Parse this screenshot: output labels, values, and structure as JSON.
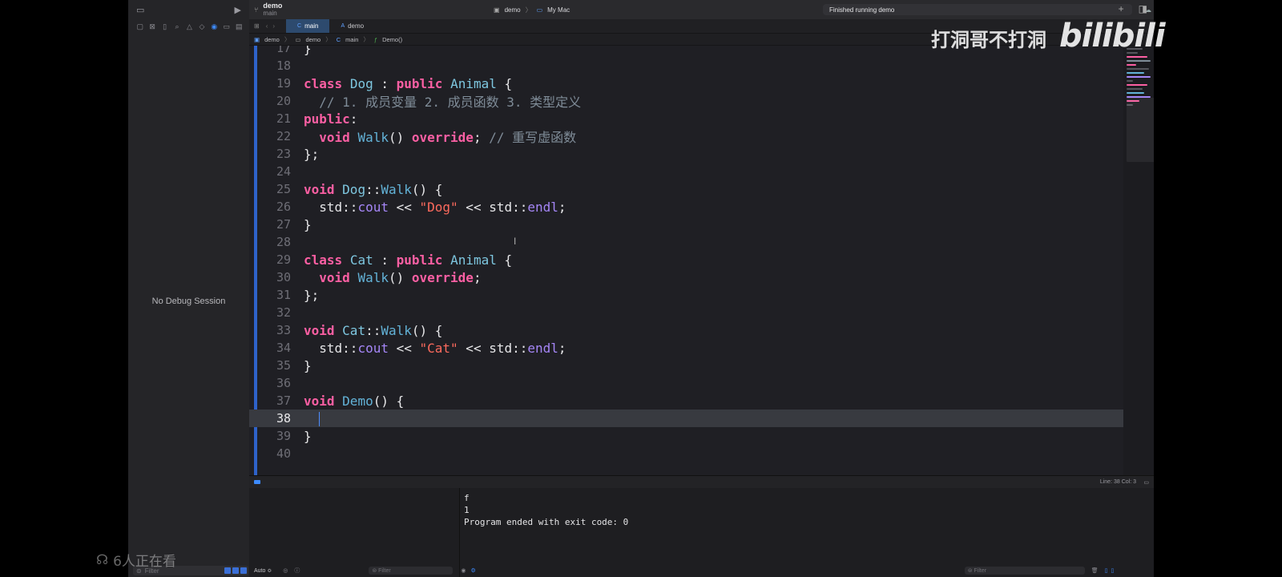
{
  "window": {
    "scheme_name": "demo",
    "scheme_branch": "main",
    "destination_scheme": "demo",
    "destination_device": "My Mac",
    "status": "Finished running demo"
  },
  "tabs": [
    {
      "label": "main",
      "active": true
    },
    {
      "label": "demo",
      "active": false
    }
  ],
  "jumpbar": [
    "demo",
    "demo",
    "main",
    "Demo()"
  ],
  "navigator": {
    "no_debug": "No Debug Session",
    "filter_placeholder": "Filter"
  },
  "editor": {
    "lines": [
      {
        "n": "17",
        "text": "}"
      },
      {
        "n": "18",
        "text": ""
      },
      {
        "n": "19",
        "text": "class Dog : public Animal {"
      },
      {
        "n": "20",
        "text": "  // 1. 成员变量 2. 成员函数 3. 类型定义"
      },
      {
        "n": "21",
        "text": "public:"
      },
      {
        "n": "22",
        "text": "  void Walk() override; // 重写虚函数"
      },
      {
        "n": "23",
        "text": "};"
      },
      {
        "n": "24",
        "text": ""
      },
      {
        "n": "25",
        "text": "void Dog::Walk() {"
      },
      {
        "n": "26",
        "text": "  std::cout << \"Dog\" << std::endl;"
      },
      {
        "n": "27",
        "text": "}"
      },
      {
        "n": "28",
        "text": ""
      },
      {
        "n": "29",
        "text": "class Cat : public Animal {"
      },
      {
        "n": "30",
        "text": "  void Walk() override;"
      },
      {
        "n": "31",
        "text": "};"
      },
      {
        "n": "32",
        "text": ""
      },
      {
        "n": "33",
        "text": "void Cat::Walk() {"
      },
      {
        "n": "34",
        "text": "  std::cout << \"Cat\" << std::endl;"
      },
      {
        "n": "35",
        "text": "}"
      },
      {
        "n": "36",
        "text": ""
      },
      {
        "n": "37",
        "text": "void Demo() {"
      },
      {
        "n": "38",
        "text": ""
      },
      {
        "n": "39",
        "text": "}"
      },
      {
        "n": "40",
        "text": ""
      }
    ],
    "current_line": "38",
    "cursor_position": "Line: 38  Col: 3"
  },
  "debug": {
    "auto_label": "Auto ≎",
    "filter_placeholder": "Filter",
    "console_lines": [
      "f",
      "1",
      "Program ended with exit code: 0"
    ]
  },
  "overlay": {
    "watermark": "打洞哥不打洞",
    "bilibili": "bilibili",
    "viewers": "6人正在看"
  },
  "colors": {
    "keyword": "#fc5fa3",
    "type": "#7ec7e0",
    "function": "#63b3d8",
    "string": "#fc6a5d",
    "comment": "#7f8c98",
    "library": "#a586f7",
    "accent": "#3d8bff"
  }
}
